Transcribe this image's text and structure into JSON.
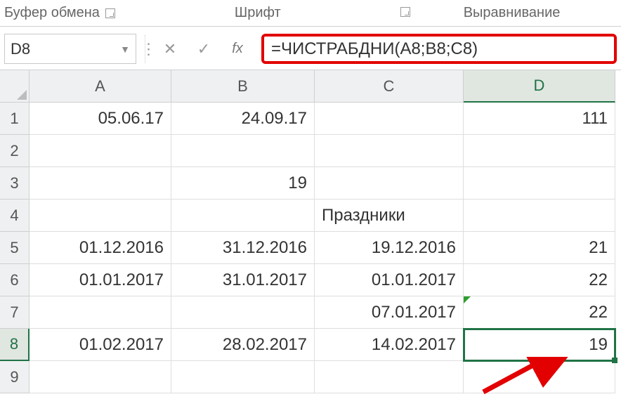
{
  "ribbon": {
    "group_clipboard": "Буфер обмена",
    "group_font": "Шрифт",
    "group_alignment": "Выравнивание"
  },
  "formula_bar": {
    "name_box": "D8",
    "fx_symbol": "fx",
    "formula": "=ЧИСТРАБДНИ(A8;B8;C8)"
  },
  "columns": [
    "A",
    "B",
    "C",
    "D"
  ],
  "rows": [
    "1",
    "2",
    "3",
    "4",
    "5",
    "6",
    "7",
    "8",
    "9"
  ],
  "cells": {
    "A1": "05.06.17",
    "B1": "24.09.17",
    "D1": "111",
    "B3": "19",
    "C4": "Праздники",
    "A5": "01.12.2016",
    "B5": "31.12.2016",
    "C5": "19.12.2016",
    "D5": "21",
    "A6": "01.01.2017",
    "B6": "31.01.2017",
    "C6": "01.01.2017",
    "D6": "22",
    "C7": "07.01.2017",
    "D7": "22",
    "A8": "01.02.2017",
    "B8": "28.02.2017",
    "C8": "14.02.2017",
    "D8": "19"
  },
  "active_cell": "D8"
}
